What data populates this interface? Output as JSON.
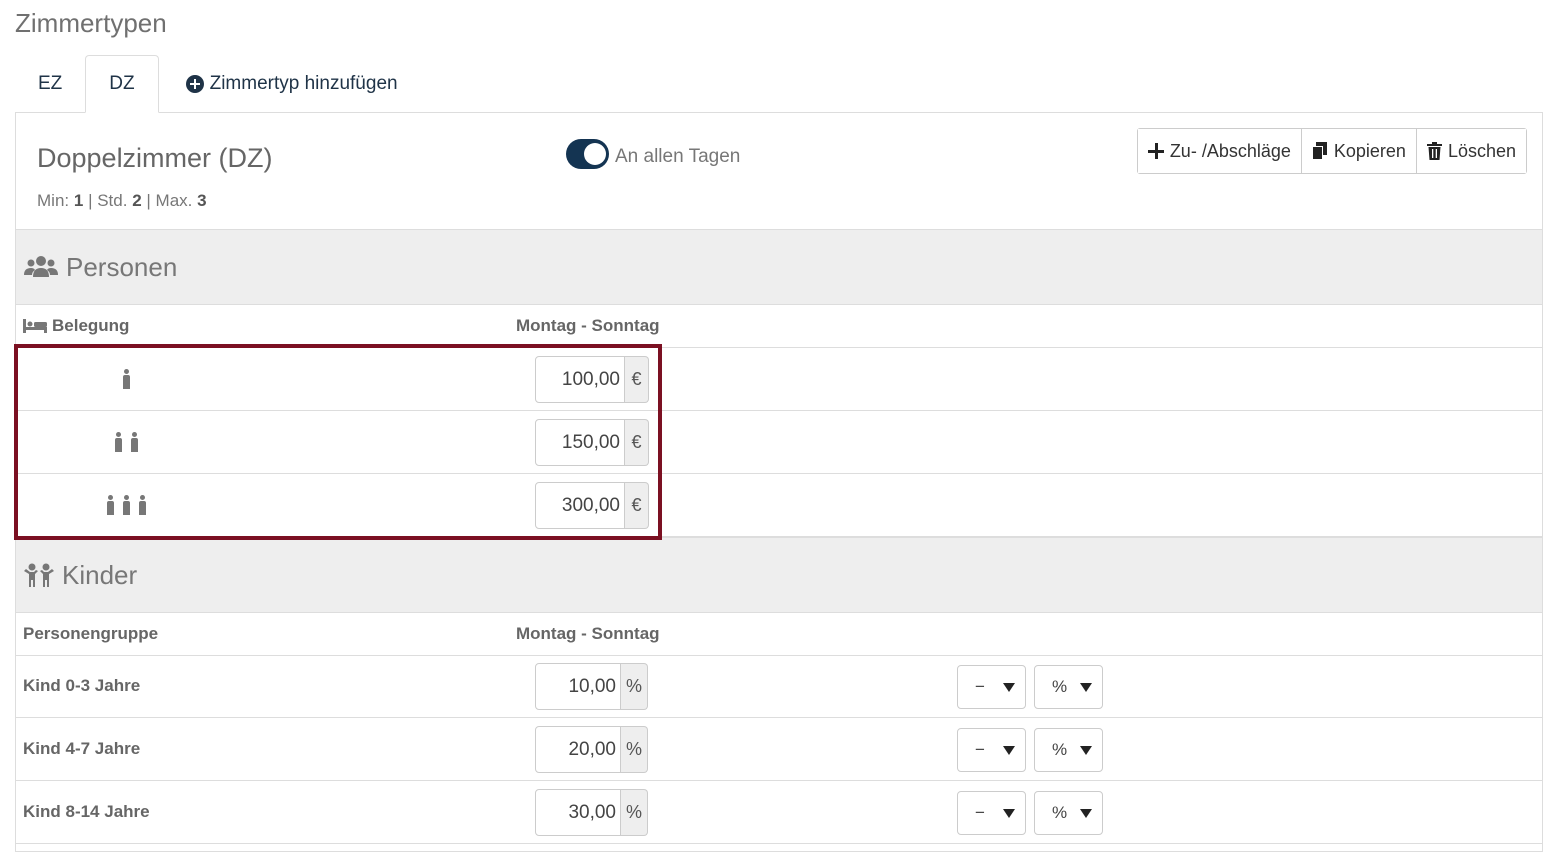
{
  "page_title": "Zimmertypen",
  "tabs": [
    {
      "label": "EZ"
    },
    {
      "label": "DZ"
    },
    {
      "label": "Zimmertyp hinzufügen"
    }
  ],
  "room": {
    "name": "Doppelzimmer (DZ)",
    "min_label": "Min:",
    "min_value": "1",
    "std_label": "| Std.",
    "std_value": "2",
    "max_label": "| Max.",
    "max_value": "3",
    "toggle_label": "An allen Tagen"
  },
  "actions": {
    "surcharges": "Zu- /Abschläge",
    "copy": "Kopieren",
    "delete": "Löschen"
  },
  "personen": {
    "title": "Personen",
    "col_occupancy": "Belegung",
    "col_days": "Montag - Sonntag",
    "rows": [
      {
        "persons": 1,
        "price": "100,00",
        "unit": "€"
      },
      {
        "persons": 2,
        "price": "150,00",
        "unit": "€"
      },
      {
        "persons": 3,
        "price": "300,00",
        "unit": "€"
      }
    ]
  },
  "kinder": {
    "title": "Kinder",
    "col_group": "Personengruppe",
    "col_days": "Montag - Sonntag",
    "rows": [
      {
        "label": "Kind 0-3 Jahre",
        "value": "10,00",
        "unit": "%",
        "op": "−",
        "type": "%"
      },
      {
        "label": "Kind 4-7 Jahre",
        "value": "20,00",
        "unit": "%",
        "op": "−",
        "type": "%"
      },
      {
        "label": "Kind 8-14 Jahre",
        "value": "30,00",
        "unit": "%",
        "op": "−",
        "type": "%"
      }
    ]
  },
  "colors": {
    "accent": "#143452",
    "highlight": "#7b1022",
    "section_bg": "#eeeeee"
  }
}
